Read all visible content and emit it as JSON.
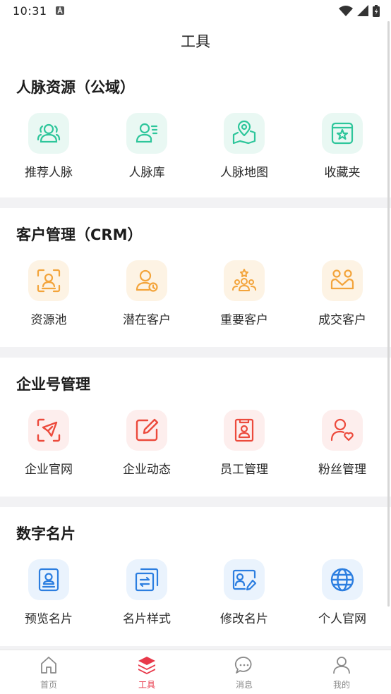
{
  "status_bar": {
    "time": "10:31"
  },
  "nav": {
    "title": "工具"
  },
  "sections": [
    {
      "title": "人脉资源（公域）",
      "items": [
        {
          "label": "推荐人脉",
          "icon": "people-recommend-icon"
        },
        {
          "label": "人脉库",
          "icon": "contact-library-icon"
        },
        {
          "label": "人脉地图",
          "icon": "map-pin-icon"
        },
        {
          "label": "收藏夹",
          "icon": "favorites-star-icon"
        }
      ]
    },
    {
      "title": "客户管理（CRM）",
      "items": [
        {
          "label": "资源池",
          "icon": "scan-person-icon"
        },
        {
          "label": "潜在客户",
          "icon": "person-clock-icon"
        },
        {
          "label": "重要客户",
          "icon": "vip-group-icon"
        },
        {
          "label": "成交客户",
          "icon": "handshake-icon"
        }
      ]
    },
    {
      "title": "企业号管理",
      "items": [
        {
          "label": "企业官网",
          "icon": "send-arrow-icon"
        },
        {
          "label": "企业动态",
          "icon": "edit-note-icon"
        },
        {
          "label": "员工管理",
          "icon": "employee-badge-icon"
        },
        {
          "label": "粉丝管理",
          "icon": "person-heart-icon"
        }
      ]
    },
    {
      "title": "数字名片",
      "items": [
        {
          "label": "预览名片",
          "icon": "card-preview-icon"
        },
        {
          "label": "名片样式",
          "icon": "card-style-icon"
        },
        {
          "label": "修改名片",
          "icon": "card-edit-icon"
        },
        {
          "label": "个人官网",
          "icon": "globe-icon"
        }
      ]
    }
  ],
  "tabbar": [
    {
      "label": "首页",
      "icon": "home-icon"
    },
    {
      "label": "工具",
      "icon": "layers-icon",
      "active": true
    },
    {
      "label": "消息",
      "icon": "chat-bubble-icon"
    },
    {
      "label": "我的",
      "icon": "user-icon"
    }
  ],
  "colors": {
    "green": "#2ec69b",
    "orange": "#f3a43b",
    "red": "#ec4a3c",
    "blue": "#2c7ee0",
    "tab_active": "#e8394a",
    "tab_inactive": "#8a8a8a"
  }
}
